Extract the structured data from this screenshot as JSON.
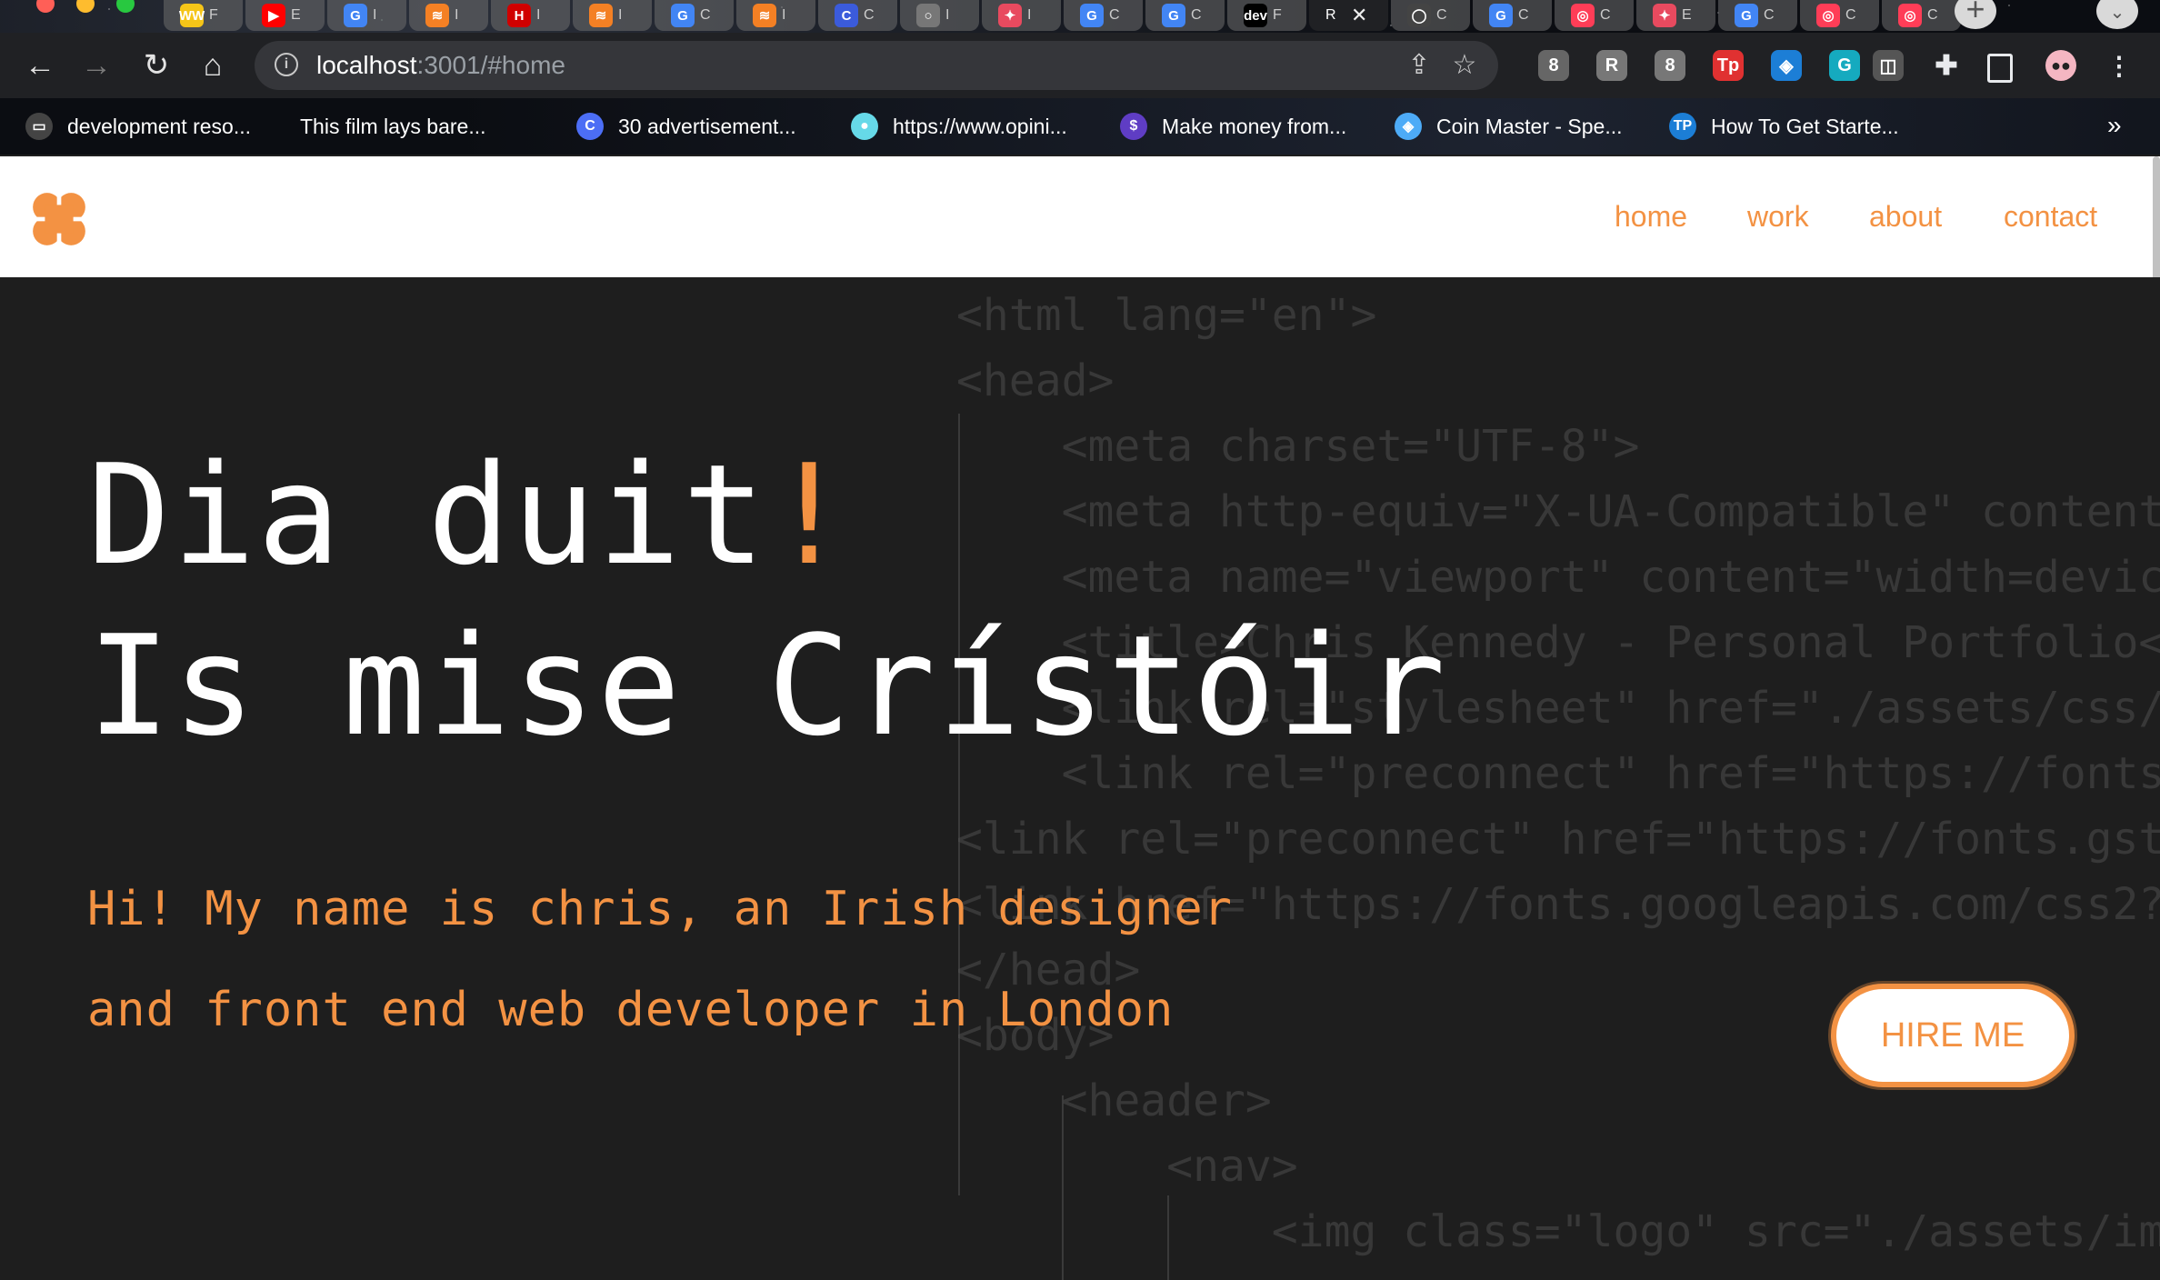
{
  "browser": {
    "tabs": [
      {
        "fav": "WW",
        "fav_color": "#f5c518",
        "text": "F"
      },
      {
        "fav": "▶",
        "fav_color": "#ff0000",
        "text": "E"
      },
      {
        "fav": "G",
        "fav_color": "#4285f4",
        "text": "I"
      },
      {
        "fav": "≋",
        "fav_color": "#f48024",
        "text": "I"
      },
      {
        "fav": "H",
        "fav_color": "#d00000",
        "text": "I"
      },
      {
        "fav": "≋",
        "fav_color": "#f48024",
        "text": "I"
      },
      {
        "fav": "G",
        "fav_color": "#4285f4",
        "text": "C"
      },
      {
        "fav": "≋",
        "fav_color": "#f48024",
        "text": "I"
      },
      {
        "fav": "C",
        "fav_color": "#3b5bdb",
        "text": "C"
      },
      {
        "fav": "○",
        "fav_color": "#777777",
        "text": "I"
      },
      {
        "fav": "✦",
        "fav_color": "#e84a5f",
        "text": "I"
      },
      {
        "fav": "G",
        "fav_color": "#4285f4",
        "text": "C"
      },
      {
        "fav": "G",
        "fav_color": "#4285f4",
        "text": "C"
      },
      {
        "fav": "dev",
        "fav_color": "#000000",
        "text": "F"
      }
    ],
    "active_tab": {
      "text": "R",
      "close": "✕"
    },
    "tabs_after": [
      {
        "fav": "◯",
        "fav_color": "#444444",
        "text": "C"
      },
      {
        "fav": "G",
        "fav_color": "#4285f4",
        "text": "C"
      },
      {
        "fav": "◎",
        "fav_color": "#ff3d57",
        "text": "C"
      },
      {
        "fav": "✦",
        "fav_color": "#e84a5f",
        "text": "E"
      },
      {
        "fav": "G",
        "fav_color": "#4285f4",
        "text": "C"
      },
      {
        "fav": "◎",
        "fav_color": "#ff3d57",
        "text": "C"
      },
      {
        "fav": "◎",
        "fav_color": "#ff3d57",
        "text": "C"
      }
    ],
    "new_tab_symbol": "+",
    "tab_search_symbol": "⌄",
    "url_host": "localhost",
    "url_rest": ":3001/#home",
    "info_symbol": "i",
    "extensions": [
      {
        "label": "8",
        "color": "#666666"
      },
      {
        "label": "R",
        "color": "#777777"
      },
      {
        "label": "8",
        "color": "#777777"
      },
      {
        "label": "Tp",
        "color": "#e03131"
      },
      {
        "label": "◈",
        "color": "#1c7ed6"
      },
      {
        "label": "G",
        "color": "#15aabf"
      },
      {
        "label": "◫",
        "color": "#555555"
      }
    ],
    "bookmarks": [
      {
        "icon": "▭",
        "icon_color": "#444444",
        "label": "development reso..."
      },
      {
        "icon": "",
        "icon_color": "transparent",
        "label": "This film lays bare..."
      },
      {
        "icon": "C",
        "icon_color": "#4c6ef5",
        "label": "30 advertisement..."
      },
      {
        "icon": "●",
        "icon_color": "#66d9e8",
        "label": "https://www.opini..."
      },
      {
        "icon": "$",
        "icon_color": "#5f3dc4",
        "label": "Make money from..."
      },
      {
        "icon": "◈",
        "icon_color": "#4dabf7",
        "label": "Coin Master - Spe..."
      },
      {
        "icon": "TP",
        "icon_color": "#1c7ed6",
        "label": "How To Get Starte..."
      }
    ],
    "bookmarks_more": "»"
  },
  "site": {
    "nav": [
      "home",
      "work",
      "about",
      "contact"
    ],
    "heading_line1": "Dia duit",
    "heading_bang": "!",
    "heading_line2": "Is mise Crístóir",
    "intro_line1": "Hi! My name is chris, an Irish designer",
    "intro_line2": "and front end web developer in London",
    "hire_button": "HIRE ME",
    "accent_color": "#f39243",
    "code_lines": [
      "<html lang=\"en\">",
      "<head>",
      "    <meta charset=\"UTF-8\">",
      "    <meta http-equiv=\"X-UA-Compatible\" content",
      "    <meta name=\"viewport\" content=\"width=devic",
      "    <title>Chris Kennedy - Personal Portfolio<",
      "    <link rel=\"stylesheet\" href=\"./assets/css/",
      "    <link rel=\"preconnect\" href=\"https://fonts",
      "<link rel=\"preconnect\" href=\"https://fonts.gst",
      "<link href=\"https://fonts.googleapis.com/css2?",
      "</head>",
      "<body>",
      "    <header>",
      "        <nav>",
      "            <img class=\"logo\" src=\"./assets/im"
    ]
  }
}
